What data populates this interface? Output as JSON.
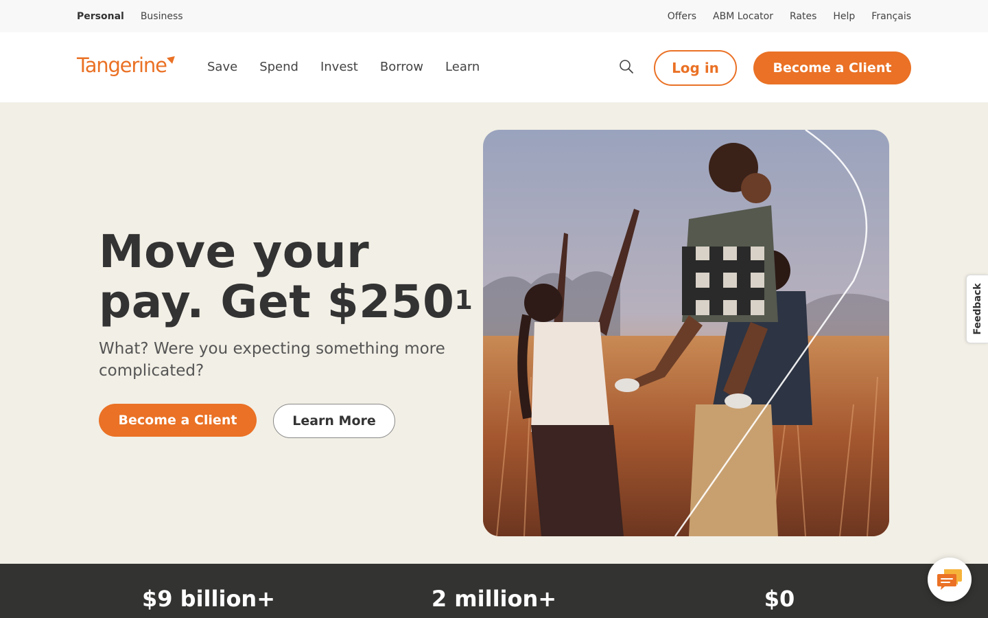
{
  "util_bar": {
    "left": [
      "Personal",
      "Business"
    ],
    "right": [
      "Offers",
      "ABM Locator",
      "Rates",
      "Help",
      "Français"
    ]
  },
  "logo": {
    "text": "Tangerine"
  },
  "nav": {
    "links": [
      "Save",
      "Spend",
      "Invest",
      "Borrow",
      "Learn"
    ],
    "login_label": "Log in",
    "become_client_label": "Become a Client"
  },
  "hero": {
    "title_line1": "Move your",
    "title_line2": "pay. Get $250",
    "title_sup": "1",
    "subtitle": "What? Were you expecting something more complicated?",
    "cta_primary": "Become a Client",
    "cta_secondary": "Learn More"
  },
  "feedback": {
    "label": "Feedback"
  },
  "stats": [
    "$9 billion+",
    "2 million+",
    "$0"
  ],
  "colors": {
    "brand_orange": "#ea7125",
    "dark_band": "#333331",
    "hero_bg": "#f2efe6"
  },
  "icons": {
    "search": "search-icon",
    "chat": "chat-icon"
  }
}
